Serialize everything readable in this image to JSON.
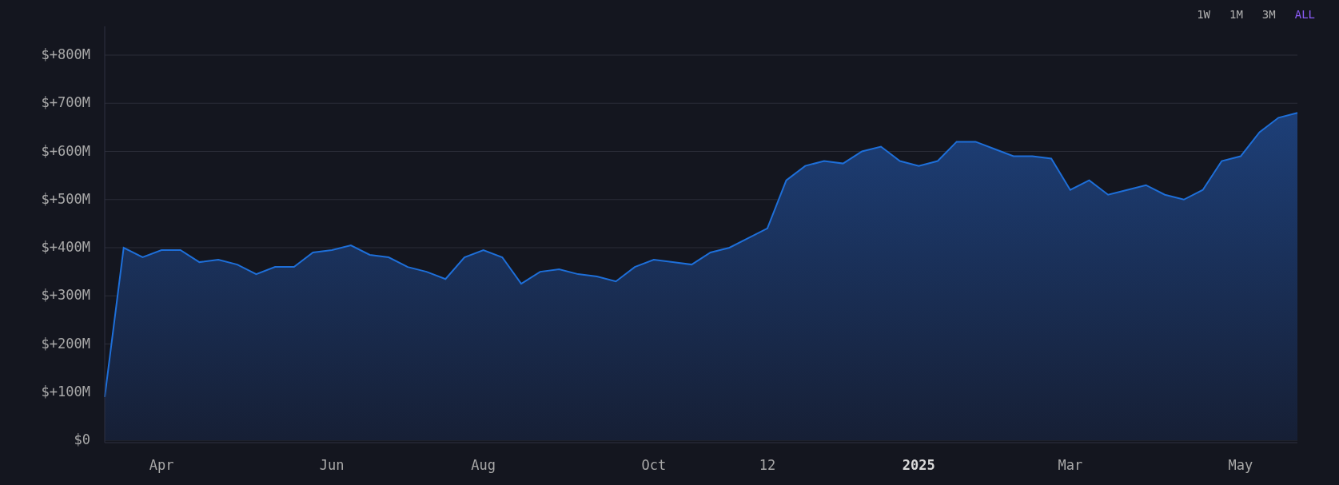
{
  "range_tabs": [
    {
      "label": "1W",
      "selected": false
    },
    {
      "label": "1M",
      "selected": false
    },
    {
      "label": "3M",
      "selected": false
    },
    {
      "label": "ALL",
      "selected": true
    }
  ],
  "chart": {
    "chart_data": {
      "type": "area",
      "grid": true,
      "ylim": [
        0,
        860
      ],
      "yticks": [
        {
          "value": 0,
          "label": "$0"
        },
        {
          "value": 100,
          "label": "$+100M"
        },
        {
          "value": 200,
          "label": "$+200M"
        },
        {
          "value": 300,
          "label": "$+300M"
        },
        {
          "value": 400,
          "label": "$+400M"
        },
        {
          "value": 500,
          "label": "$+500M"
        },
        {
          "value": 600,
          "label": "$+600M"
        },
        {
          "value": 700,
          "label": "$+700M"
        },
        {
          "value": 800,
          "label": "$+800M"
        }
      ],
      "categories": [
        null,
        null,
        null,
        "Apr",
        null,
        null,
        null,
        null,
        null,
        null,
        null,
        null,
        "Jun",
        null,
        null,
        null,
        null,
        null,
        null,
        null,
        "Aug",
        null,
        null,
        null,
        null,
        null,
        null,
        null,
        null,
        "Oct",
        null,
        null,
        null,
        null,
        null,
        "12",
        null,
        null,
        null,
        null,
        null,
        null,
        null,
        "2025",
        null,
        null,
        null,
        null,
        null,
        null,
        null,
        "Mar",
        null,
        null,
        null,
        null,
        null,
        null,
        null,
        null,
        "May",
        null,
        null,
        null
      ],
      "series": [
        {
          "color": "#1e6fd9",
          "values": [
            90,
            400,
            380,
            395,
            395,
            370,
            375,
            365,
            345,
            360,
            360,
            390,
            395,
            405,
            385,
            380,
            360,
            350,
            335,
            380,
            395,
            380,
            325,
            350,
            355,
            345,
            340,
            330,
            360,
            375,
            370,
            365,
            390,
            400,
            420,
            440,
            540,
            570,
            580,
            575,
            600,
            610,
            580,
            570,
            580,
            620,
            620,
            605,
            590,
            590,
            585,
            520,
            540,
            510,
            520,
            530,
            510,
            500,
            520,
            580,
            590,
            640,
            670,
            680
          ]
        }
      ]
    }
  }
}
